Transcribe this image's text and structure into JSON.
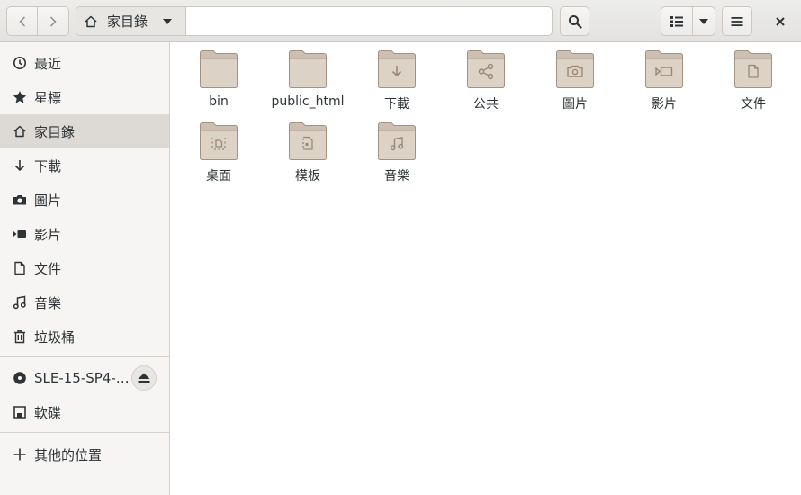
{
  "headerbar": {
    "location": "家目錄"
  },
  "sidebar": {
    "places": [
      {
        "label": "最近",
        "icon": "clock-icon"
      },
      {
        "label": "星標",
        "icon": "star-icon"
      },
      {
        "label": "家目錄",
        "icon": "home-icon",
        "active": true
      },
      {
        "label": "下載",
        "icon": "download-icon"
      },
      {
        "label": "圖片",
        "icon": "camera-icon"
      },
      {
        "label": "影片",
        "icon": "video-icon"
      },
      {
        "label": "文件",
        "icon": "document-icon"
      },
      {
        "label": "音樂",
        "icon": "music-icon"
      },
      {
        "label": "垃圾桶",
        "icon": "trash-icon"
      }
    ],
    "devices": [
      {
        "label": "SLE-15-SP4-…",
        "icon": "disc-icon"
      },
      {
        "label": "軟碟",
        "icon": "floppy-icon"
      }
    ],
    "other_locations": {
      "label": "其他的位置",
      "icon": "plus-icon"
    }
  },
  "files": [
    {
      "name": "bin",
      "emblem": "none"
    },
    {
      "name": "public_html",
      "emblem": "none"
    },
    {
      "name": "下載",
      "emblem": "download"
    },
    {
      "name": "公共",
      "emblem": "share"
    },
    {
      "name": "圖片",
      "emblem": "camera"
    },
    {
      "name": "影片",
      "emblem": "video"
    },
    {
      "name": "文件",
      "emblem": "document"
    },
    {
      "name": "桌面",
      "emblem": "desktop"
    },
    {
      "name": "模板",
      "emblem": "template"
    },
    {
      "name": "音樂",
      "emblem": "music"
    }
  ],
  "colors": {
    "folder": "#ddd2c6",
    "folder_tab": "#cdc0b2",
    "folder_stroke": "#a39282",
    "emblem": "#9a8877",
    "sidebar_active": "#dddad6"
  }
}
